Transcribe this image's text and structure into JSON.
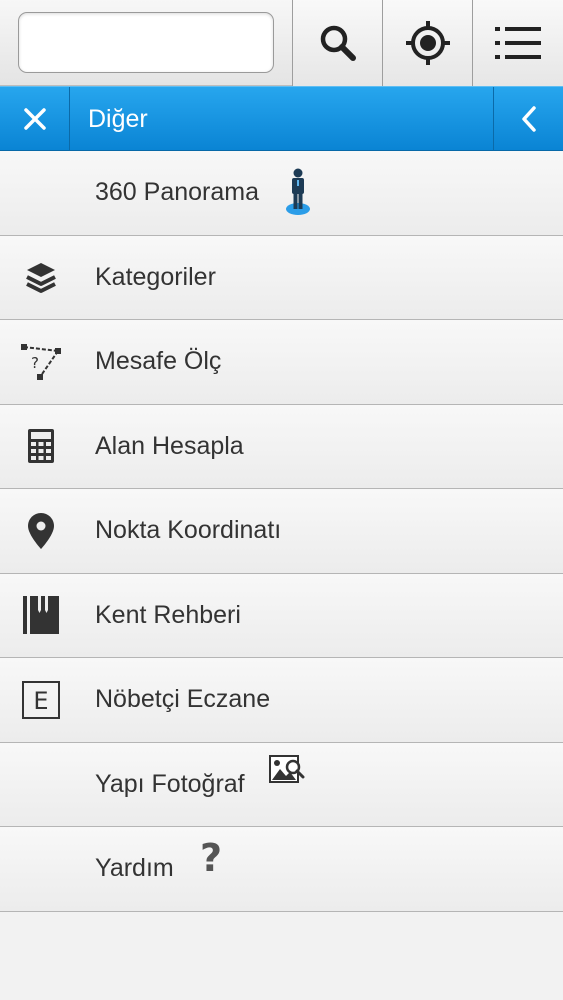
{
  "toolbar": {
    "search_value": "",
    "search_placeholder": "",
    "buttons": [
      {
        "icon": "search-icon"
      },
      {
        "icon": "locate-icon"
      },
      {
        "icon": "menu-icon"
      }
    ]
  },
  "header": {
    "title": "Diğer",
    "close_icon": "close-icon",
    "back_icon": "chevron-left-icon",
    "background": "#1497e2"
  },
  "menu": {
    "items": [
      {
        "label": "360 Panorama",
        "icon": "pegman-icon"
      },
      {
        "label": "Kategoriler",
        "icon": "layers-icon"
      },
      {
        "label": "Mesafe Ölç",
        "icon": "measure-distance-icon"
      },
      {
        "label": "Alan Hesapla",
        "icon": "calculator-icon"
      },
      {
        "label": "Nokta Koordinatı",
        "icon": "map-pin-icon"
      },
      {
        "label": "Kent Rehberi",
        "icon": "city-guide-book-icon"
      },
      {
        "label": "Nöbetçi Eczane",
        "icon": "pharmacy-e-icon"
      },
      {
        "label": "Yapı Fotoğraf",
        "icon": "photo-search-icon"
      },
      {
        "label": "Yardım",
        "icon": "help-question-icon"
      }
    ]
  }
}
